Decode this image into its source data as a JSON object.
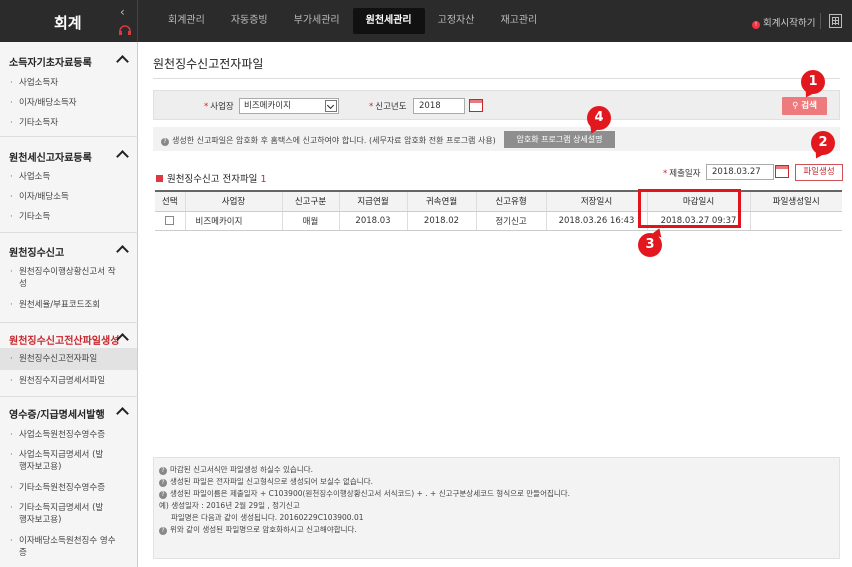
{
  "topbar": {
    "brand": "회계",
    "nav": [
      "회계관리",
      "자동증빙",
      "부가세관리",
      "원천세관리",
      "고정자산",
      "재고관리"
    ],
    "active_nav": "원천세관리",
    "start_link": "회계시작하기"
  },
  "sidebar": {
    "sections": [
      {
        "title": "소득자기초자료등록",
        "items": [
          "사업소득자",
          "이자/배당소득자",
          "기타소득자"
        ]
      },
      {
        "title": "원천세신고자료등록",
        "items": [
          "사업소득",
          "이자/배당소득",
          "기타소득"
        ]
      },
      {
        "title": "원천징수신고",
        "items": [
          "원천징수이행상황신고서 작성",
          "원천세율/부표코드조회"
        ]
      },
      {
        "title": "원천징수신고전산파일생성",
        "items": [
          "원천징수신고전자파일",
          "원천징수지급명세서파일"
        ]
      },
      {
        "title": "영수증/지급명세서발행",
        "items": [
          "사업소득원천징수영수증",
          "사업소득지급명세서 (발행자보고용)",
          "기타소득원천징수영수증",
          "기타소득지급명세서 (발행자보고용)",
          "이자배당소득원천징수 영수증"
        ]
      }
    ]
  },
  "main": {
    "title": "원천징수신고전자파일",
    "search": {
      "business_label": "사업장",
      "business_value": "비즈메카이지",
      "year_label": "신고년도",
      "year_value": "2018",
      "search_button": "검색"
    },
    "notice": {
      "text": "생성한 신고파일은 암호화 후 홈택스에 신고하여야 합니다. (세무자료 암호화 전환 프로그램 사용)",
      "button": "암호화 프로그램 상세설명"
    },
    "list": {
      "title": "원천징수신고 전자파일",
      "count": "1",
      "submit_label": "제출일자",
      "submit_value": "2018.03.27",
      "file_button": "파일생성",
      "columns": [
        "선택",
        "사업장",
        "신고구분",
        "지급연월",
        "귀속연월",
        "신고유형",
        "저장일시",
        "마감일시",
        "파일생성일시"
      ],
      "rows": [
        [
          "",
          "비즈메카이지",
          "매월",
          "2018.03",
          "2018.02",
          "정기신고",
          "2018.03.26 16:43",
          "2018.03.27 09:37",
          ""
        ]
      ]
    },
    "footer_notes": [
      "마감된 신고서식만 파일생성 하실수 있습니다.",
      "생성된 파일은 전자파일 신고형식으로 생성되어 보실수 없습니다.",
      "생성된 파일이름은 제출일자 + C103900(원천징수이행상황신고서 서식코드) + . + 신고구분상세코드 형식으로 만들어집니다.",
      "예) 생성일자 : 2016년 2월 29일 , 정기신고",
      "파일명은 다음과 같이 생성됩니다. 20160229C103900.01",
      "위와 같이 생성된 파일명으로 암호화하시고 신고해야합니다."
    ]
  },
  "badges": [
    "1",
    "2",
    "3",
    "4"
  ],
  "colors": {
    "accent_red": "#e3181f",
    "topbar": "#2b2b2b",
    "search_button": "#ed7b7e"
  }
}
